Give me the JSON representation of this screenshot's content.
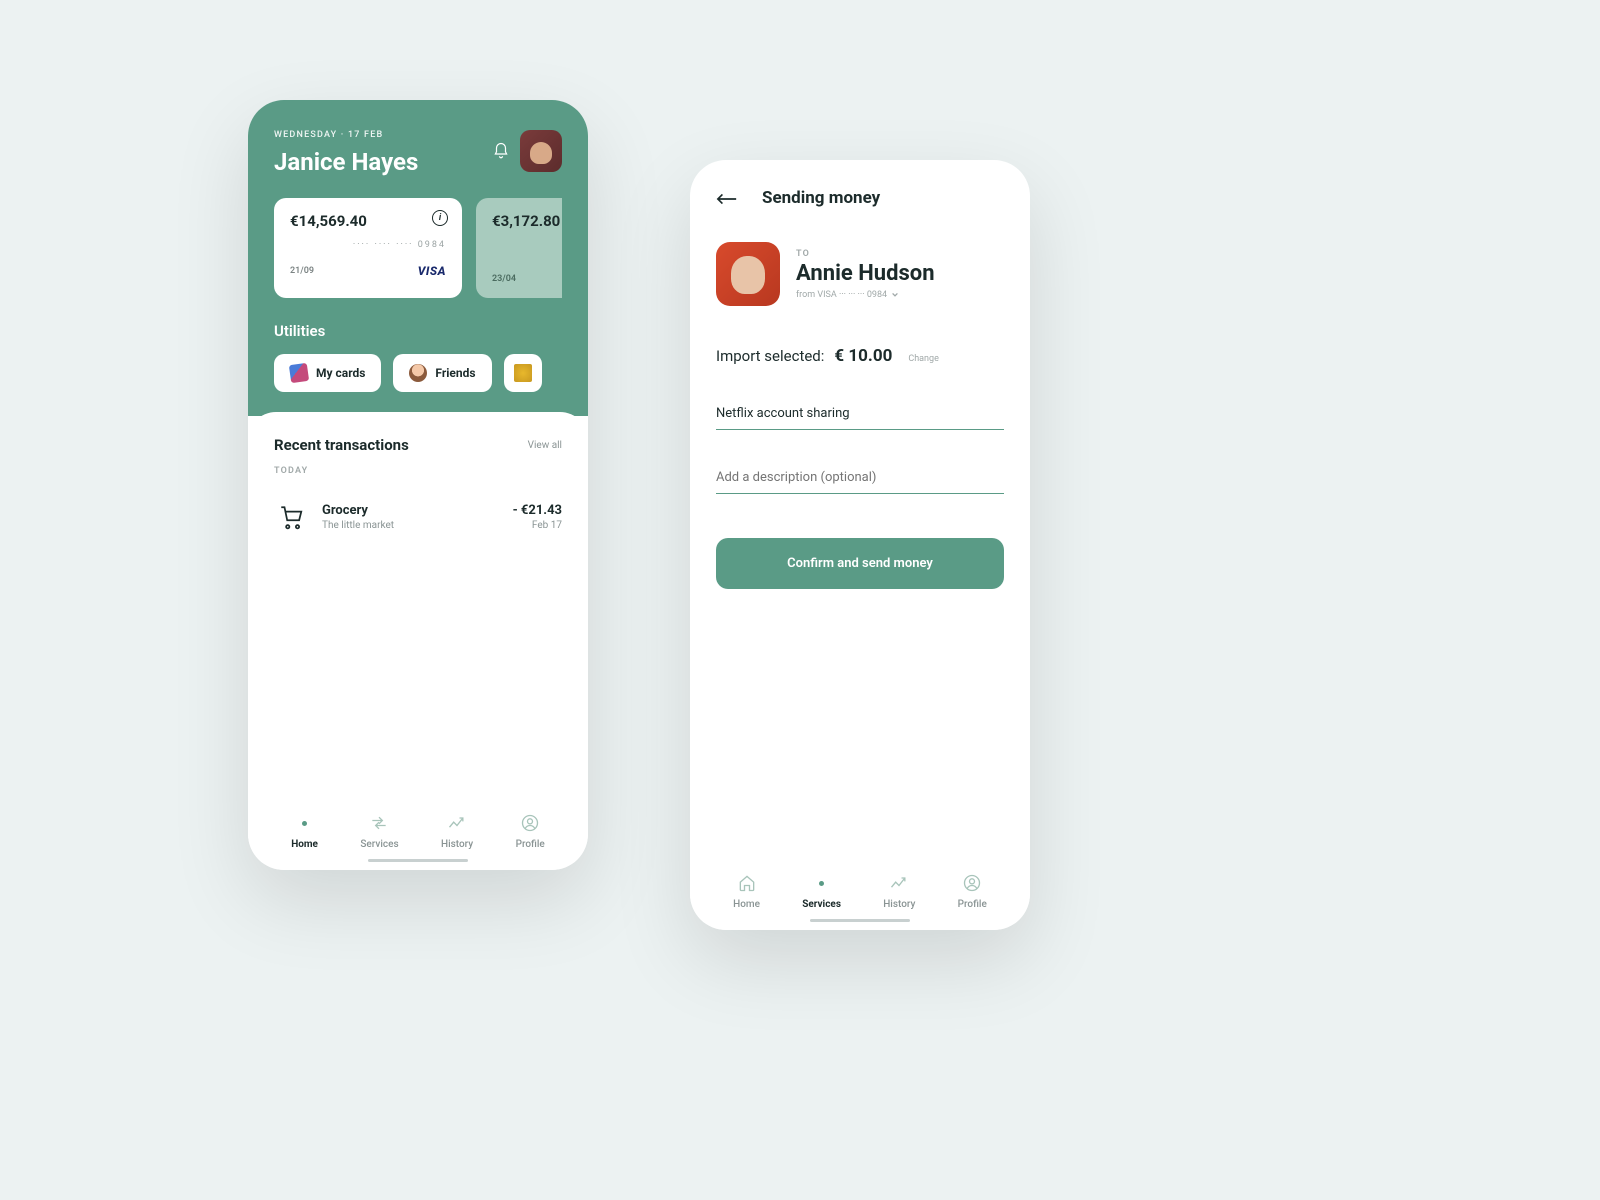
{
  "home": {
    "date": "WEDNESDAY · 17 FEB",
    "user_name": "Janice Hayes",
    "cards": [
      {
        "balance": "€14,569.40",
        "masked_number": "····  ····  ····  0984",
        "expiry": "21/09",
        "brand": "VISA"
      },
      {
        "balance": "€3,172.80",
        "expiry": "23/04"
      }
    ],
    "utilities_label": "Utilities",
    "chips": [
      {
        "label": "My cards"
      },
      {
        "label": "Friends"
      }
    ],
    "recent": {
      "title": "Recent transactions",
      "view_all": "View all",
      "day_label": "TODAY",
      "items": [
        {
          "name": "Grocery",
          "subtitle": "The little market",
          "amount": "- €21.43",
          "date": "Feb 17"
        }
      ]
    },
    "nav": {
      "home": "Home",
      "services": "Services",
      "history": "History",
      "profile": "Profile"
    }
  },
  "send": {
    "title": "Sending money",
    "to_label": "TO",
    "recipient_name": "Annie Hudson",
    "from_line": "from VISA ··· ··· ···   0984",
    "import_label": "Import selected:",
    "import_amount": "€ 10.00",
    "change_label": "Change",
    "note_value": "Netflix account sharing",
    "description_placeholder": "Add a description (optional)",
    "confirm_label": "Confirm and send money",
    "nav": {
      "home": "Home",
      "services": "Services",
      "history": "History",
      "profile": "Profile"
    }
  }
}
